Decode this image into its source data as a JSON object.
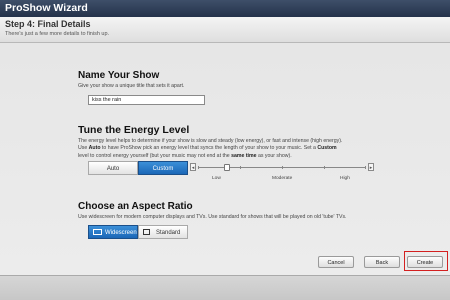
{
  "window": {
    "title": "ProShow Wizard"
  },
  "step": {
    "title": "Step 4: Final Details",
    "subtitle": "There's just a few more details to finish up."
  },
  "name_section": {
    "title": "Name Your Show",
    "description": "Give your show a unique title that sets it apart.",
    "show_name": "kiss the rain"
  },
  "energy_section": {
    "title": "Tune the Energy Level",
    "line1": "The energy level helps to determine if your show is slow and steady (low energy), or fast and intense (high energy).",
    "line2a": "Use ",
    "line2b": "Auto",
    "line2c": " to have ProShow pick an energy level that syncs the length of your show to your music. Set a ",
    "line2d": "Custom",
    "line3a": "level to control energy yourself (but your music may not end at the ",
    "line3b": "same time",
    "line3c": " as your show).",
    "modes": [
      "Auto",
      "Custom"
    ],
    "selected_mode": "Custom",
    "level_labels": [
      "Low",
      "Moderate",
      "High"
    ],
    "slider_level": 0.17,
    "left_arrow": "◂",
    "right_arrow": "▸"
  },
  "aspect_section": {
    "title": "Choose an Aspect Ratio",
    "description": "Use widescreen for modern computer displays and TVs. Use standard for shows that will be played on old 'tube' TVs.",
    "options": [
      "Widescreen",
      "Standard"
    ],
    "selected": "Widescreen"
  },
  "footer": {
    "cancel": "Cancel",
    "back": "Back",
    "create": "Create",
    "highlight_color": "#d32020"
  }
}
